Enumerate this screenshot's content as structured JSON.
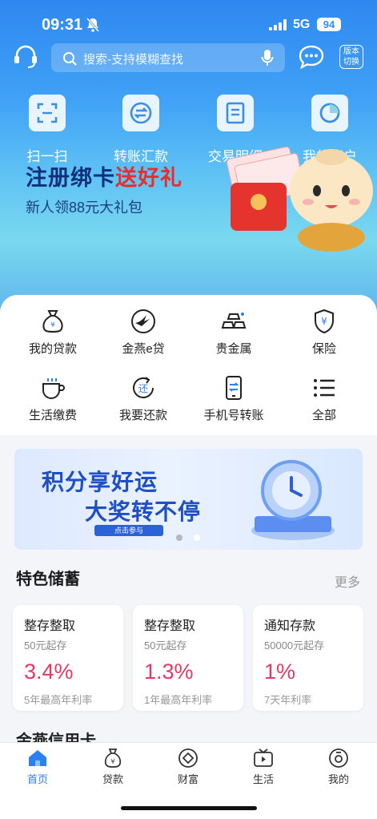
{
  "status": {
    "time": "09:31",
    "network": "5G",
    "battery": "94"
  },
  "header": {
    "search_placeholder": "搜索-支持模糊查找",
    "version_switch": "版本切换",
    "icons": [
      "customer-service-icon",
      "search-icon",
      "microphone-icon",
      "message-icon"
    ]
  },
  "quick_actions": [
    {
      "label": "扫一扫",
      "icon": "scan-icon"
    },
    {
      "label": "转账汇款",
      "icon": "transfer-icon"
    },
    {
      "label": "交易明细",
      "icon": "statement-icon"
    },
    {
      "label": "我的账户",
      "icon": "account-pie-icon"
    }
  ],
  "hero_banner": {
    "title_part1": "注册绑卡",
    "title_part2": "送好礼",
    "subtitle": "新人领88元大礼包"
  },
  "services": [
    {
      "label": "我的贷款",
      "icon": "loan-bag-icon"
    },
    {
      "label": "金燕e贷",
      "icon": "swallow-icon"
    },
    {
      "label": "贵金属",
      "icon": "gold-bars-icon"
    },
    {
      "label": "保险",
      "icon": "shield-yuan-icon"
    },
    {
      "label": "生活缴费",
      "icon": "cup-icon"
    },
    {
      "label": "我要还款",
      "icon": "repay-icon"
    },
    {
      "label": "手机号转账",
      "icon": "phone-transfer-icon"
    },
    {
      "label": "全部",
      "icon": "list-icon"
    }
  ],
  "promo": {
    "line1": "积分享好运",
    "line2": "大奖转不停",
    "cta": "点击参与",
    "page_count": 2,
    "active_page": 2
  },
  "savings": {
    "title": "特色储蓄",
    "more": "更多",
    "products": [
      {
        "name": "整存整取",
        "min": "50元起存",
        "rate": "3.4%",
        "note": "5年最高年利率"
      },
      {
        "name": "整存整取",
        "min": "50元起存",
        "rate": "1.3%",
        "note": "1年最高年利率"
      },
      {
        "name": "通知存款",
        "min": "50000元起存",
        "rate": "1%",
        "note": "7天年利率"
      }
    ]
  },
  "next_section_peek": "金燕信用卡",
  "tabbar": [
    {
      "label": "首页",
      "icon": "home-icon",
      "active": true
    },
    {
      "label": "贷款",
      "icon": "loan-icon",
      "active": false
    },
    {
      "label": "财富",
      "icon": "wealth-icon",
      "active": false
    },
    {
      "label": "生活",
      "icon": "tv-icon",
      "active": false
    },
    {
      "label": "我的",
      "icon": "profile-icon",
      "active": false
    }
  ],
  "colors": {
    "primary": "#2d7ff0",
    "rate": "#e53862",
    "banner_title": "#0f2f7c",
    "banner_accent": "#e82d2d"
  }
}
